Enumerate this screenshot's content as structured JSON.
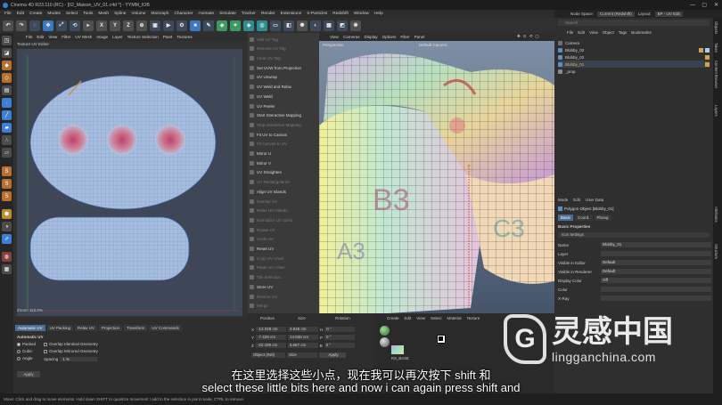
{
  "app": {
    "title": "Cinema 4D R23.110 (RC) - [02_Maison_UV_01.c4d *] - YYMM_IOB",
    "menus": [
      "File",
      "Edit",
      "Create",
      "Modes",
      "Select",
      "Tools",
      "Mesh",
      "Spline",
      "Volume",
      "MoGraph",
      "Character",
      "Animate",
      "Simulate",
      "Tracker",
      "Render",
      "Extensions",
      "X-Particles",
      "Redshift",
      "Window",
      "Help"
    ],
    "node_space_label": "Node Space:",
    "node_space_value": "Current (Redshift)",
    "layout_label": "Layout:",
    "layout_value": "BP - UV Edit"
  },
  "uv_editor": {
    "menus": [
      "File",
      "Edit",
      "View",
      "Filter",
      "UV Mesh",
      "Image",
      "Layer",
      "Texture Selection",
      "Paint",
      "Textures"
    ],
    "title": "Texture UV Editor",
    "zoom": "Zoom: 112.0%"
  },
  "uv_commands": [
    {
      "label": "Add UV Tag",
      "dim": true
    },
    {
      "label": "Remove UV Tag",
      "dim": true
    },
    {
      "label": "Clear UV Tag",
      "dim": true
    },
    {
      "label": "Set UVW from Projection",
      "dim": false
    },
    {
      "label": "UV Unwrap",
      "dim": false
    },
    {
      "label": "UV Weld and Relax",
      "dim": false
    },
    {
      "label": "UV Weld",
      "dim": false
    },
    {
      "label": "UV Peeler",
      "dim": false
    },
    {
      "label": "Start Interactive Mapping",
      "dim": false
    },
    {
      "label": "Stop Interactive Mapping",
      "dim": true
    },
    {
      "label": "Fit UV to Canvas",
      "dim": false
    },
    {
      "label": "Fit Canvas to UV",
      "dim": true
    },
    {
      "label": "Mirror U",
      "dim": false
    },
    {
      "label": "Mirror V",
      "dim": false
    },
    {
      "label": "UV Straighten",
      "dim": false
    },
    {
      "label": "UV Rectangularize",
      "dim": true
    },
    {
      "label": "Align UV Islands",
      "dim": false
    },
    {
      "label": "Overlap UV",
      "dim": true
    },
    {
      "label": "Relax UV Islands",
      "dim": true
    },
    {
      "label": "Normalize UV Sizes",
      "dim": true
    },
    {
      "label": "Rotate UV",
      "dim": true
    },
    {
      "label": "Scale UV",
      "dim": true
    },
    {
      "label": "Reset UV",
      "dim": false
    },
    {
      "label": "Copy UV Chart",
      "dim": true
    },
    {
      "label": "Paste UV Chart",
      "dim": true
    },
    {
      "label": "Tile Selection",
      "dim": true
    },
    {
      "label": "Store UV",
      "dim": false
    },
    {
      "label": "Restore UV",
      "dim": true
    },
    {
      "label": "Merge",
      "dim": true
    }
  ],
  "viewport": {
    "menus": [
      "View",
      "Cameras",
      "Display",
      "Options",
      "Filter",
      "Panel"
    ],
    "perspective": "Perspective",
    "camera": "Default Camera",
    "fps": "FPS : 400.0"
  },
  "object_manager": {
    "menus": [
      "File",
      "Edit",
      "View",
      "Object",
      "Tags",
      "Bookmarks"
    ],
    "search_placeholder": "Search",
    "objects": [
      "Camera",
      "Blobby_02",
      "Blobby_02",
      "Blobby_01",
      "_prop"
    ]
  },
  "attribute_manager": {
    "menus": [
      "Mode",
      "Edit",
      "User Data"
    ],
    "object_title": "Polygon Object [Blobby_01]",
    "tabs": [
      "Basic",
      "Coord.",
      "Phong"
    ],
    "section": "Basic Properties",
    "subsection": "Icon Settings",
    "rows": [
      {
        "label": "Name",
        "value": "Blobby_01"
      },
      {
        "label": "Layer",
        "value": ""
      },
      {
        "label": "Visible in Editor",
        "value": "Default"
      },
      {
        "label": "Visible in Renderer",
        "value": "Default"
      },
      {
        "label": "Display Color",
        "value": "Off"
      },
      {
        "label": "Color",
        "value": ""
      },
      {
        "label": "X-Ray",
        "value": ""
      }
    ],
    "side_tabs": [
      "Objects",
      "Takes",
      "Content Browser",
      "Layers",
      "Attributes",
      "Structure"
    ]
  },
  "bottom_panel": {
    "tabs": [
      "Automatic UV",
      "UV Packing",
      "Relax UV",
      "Projection",
      "Transform",
      "UV Commands"
    ],
    "section": "Automatic UV",
    "options": [
      "Packed",
      "Cubic",
      "Angle"
    ],
    "checks": [
      "Overlap Identical Geometry",
      "Overlap Mirrored Geometry"
    ],
    "spacing_label": "Spacing",
    "spacing_value": "1 %",
    "apply": "Apply"
  },
  "coordinates": {
    "headers": [
      "Position",
      "Size",
      "Rotation"
    ],
    "rows": [
      {
        "axis": "X",
        "pos": "-13.028 cm",
        "size": "3.945 cm",
        "rlabel": "H",
        "rot": "0 °"
      },
      {
        "axis": "Y",
        "pos": "-7.429 cm",
        "size": "14.838 cm",
        "rlabel": "P",
        "rot": "0 °"
      },
      {
        "axis": "Z",
        "pos": "-22.439 cm",
        "size": "3.667 cm",
        "rlabel": "B",
        "rot": "0 °"
      }
    ],
    "mode": "Object (Rel)",
    "size_mode": "Size",
    "apply": "Apply"
  },
  "material": {
    "menus": [
      "Create",
      "Edit",
      "View",
      "Select",
      "Material",
      "Texture"
    ],
    "items": [
      "RS_BASE"
    ]
  },
  "status": "Move: Click and drag to move elements. Hold down SHIFT to quantize movement / add to the selection in point mode, CTRL to remove.",
  "subtitles": {
    "line1": "在这里选择这些小点，现在我可以再次按下 shift 和",
    "line2": "select these little bits here and now i can again press shift and"
  },
  "watermark": {
    "logo_char": "G",
    "cn": "灵感中国",
    "url": "lingganchina.com"
  }
}
